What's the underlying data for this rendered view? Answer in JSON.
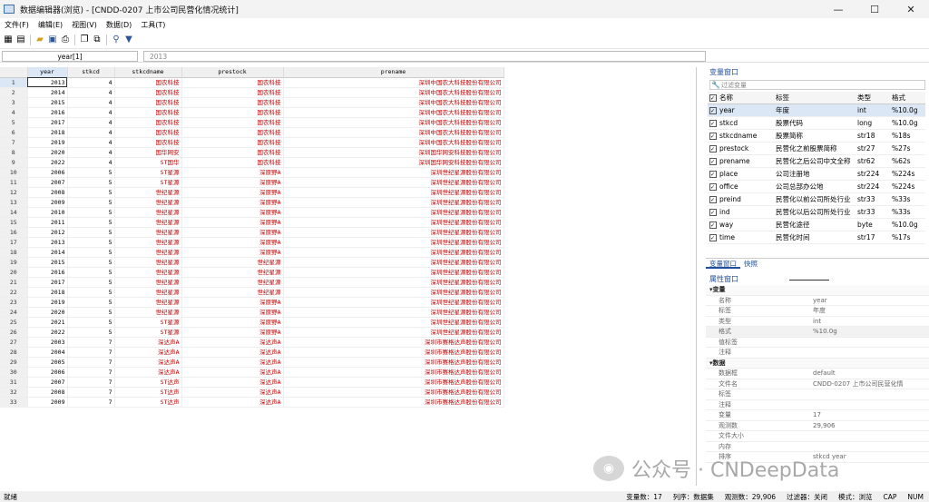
{
  "window": {
    "title": "数据编辑器(浏览) - [CNDD-0207 上市公司民营化情况统计]"
  },
  "menu": [
    "文件(F)",
    "编辑(E)",
    "视图(V)",
    "数据(D)",
    "工具(T)"
  ],
  "formula": {
    "var_ref": "year[1]",
    "cell_value": "2013"
  },
  "columns": [
    "year",
    "stkcd",
    "stkcdname",
    "prestock",
    "prename"
  ],
  "rows": [
    [
      "1",
      "2013",
      "4",
      "国农科技",
      "国农科技",
      "深圳中国农大科技股份有限公司"
    ],
    [
      "2",
      "2014",
      "4",
      "国农科技",
      "国农科技",
      "深圳中国农大科技股份有限公司"
    ],
    [
      "3",
      "2015",
      "4",
      "国农科技",
      "国农科技",
      "深圳中国农大科技股份有限公司"
    ],
    [
      "4",
      "2016",
      "4",
      "国农科技",
      "国农科技",
      "深圳中国农大科技股份有限公司"
    ],
    [
      "5",
      "2017",
      "4",
      "国农科技",
      "国农科技",
      "深圳中国农大科技股份有限公司"
    ],
    [
      "6",
      "2018",
      "4",
      "国农科技",
      "国农科技",
      "深圳中国农大科技股份有限公司"
    ],
    [
      "7",
      "2019",
      "4",
      "国农科技",
      "国农科技",
      "深圳中国农大科技股份有限公司"
    ],
    [
      "8",
      "2020",
      "4",
      "国华网安",
      "国农科技",
      "深圳国华网安科技股份有限公司"
    ],
    [
      "9",
      "2022",
      "4",
      "ST国华",
      "国农科技",
      "深圳国华网安科技股份有限公司"
    ],
    [
      "10",
      "2006",
      "5",
      "ST星源",
      "深原野A",
      "深圳世纪星源股份有限公司"
    ],
    [
      "11",
      "2007",
      "5",
      "ST星源",
      "深原野A",
      "深圳世纪星源股份有限公司"
    ],
    [
      "12",
      "2008",
      "5",
      "世纪星源",
      "深原野A",
      "深圳世纪星源股份有限公司"
    ],
    [
      "13",
      "2009",
      "5",
      "世纪星源",
      "深原野A",
      "深圳世纪星源股份有限公司"
    ],
    [
      "14",
      "2010",
      "5",
      "世纪星源",
      "深原野A",
      "深圳世纪星源股份有限公司"
    ],
    [
      "15",
      "2011",
      "5",
      "世纪星源",
      "深原野A",
      "深圳世纪星源股份有限公司"
    ],
    [
      "16",
      "2012",
      "5",
      "世纪星源",
      "深原野A",
      "深圳世纪星源股份有限公司"
    ],
    [
      "17",
      "2013",
      "5",
      "世纪星源",
      "深原野A",
      "深圳世纪星源股份有限公司"
    ],
    [
      "18",
      "2014",
      "5",
      "世纪星源",
      "深原野A",
      "深圳世纪星源股份有限公司"
    ],
    [
      "19",
      "2015",
      "5",
      "世纪星源",
      "世纪星源",
      "深圳世纪星源股份有限公司"
    ],
    [
      "20",
      "2016",
      "5",
      "世纪星源",
      "世纪星源",
      "深圳世纪星源股份有限公司"
    ],
    [
      "21",
      "2017",
      "5",
      "世纪星源",
      "世纪星源",
      "深圳世纪星源股份有限公司"
    ],
    [
      "22",
      "2018",
      "5",
      "世纪星源",
      "世纪星源",
      "深圳世纪星源股份有限公司"
    ],
    [
      "23",
      "2019",
      "5",
      "世纪星源",
      "深原野A",
      "深圳世纪星源股份有限公司"
    ],
    [
      "24",
      "2020",
      "5",
      "世纪星源",
      "深原野A",
      "深圳世纪星源股份有限公司"
    ],
    [
      "25",
      "2021",
      "5",
      "ST星源",
      "深原野A",
      "深圳世纪星源股份有限公司"
    ],
    [
      "26",
      "2022",
      "5",
      "ST星源",
      "深原野A",
      "深圳世纪星源股份有限公司"
    ],
    [
      "27",
      "2003",
      "7",
      "深达声A",
      "深达声A",
      "深圳市赛格达声股份有限公司"
    ],
    [
      "28",
      "2004",
      "7",
      "深达声A",
      "深达声A",
      "深圳市赛格达声股份有限公司"
    ],
    [
      "29",
      "2005",
      "7",
      "深达声A",
      "深达声A",
      "深圳市赛格达声股份有限公司"
    ],
    [
      "30",
      "2006",
      "7",
      "深达声A",
      "深达声A",
      "深圳市赛格达声股份有限公司"
    ],
    [
      "31",
      "2007",
      "7",
      "ST达声",
      "深达声A",
      "深圳市赛格达声股份有限公司"
    ],
    [
      "32",
      "2008",
      "7",
      "ST达声",
      "深达声A",
      "深圳市赛格达声股份有限公司"
    ],
    [
      "33",
      "2009",
      "7",
      "ST达声",
      "深达声A",
      "深圳市赛格达声股份有限公司"
    ]
  ],
  "variables_panel": {
    "title": "变量窗口",
    "filter_placeholder": "过滤变量",
    "headers": {
      "name": "名称",
      "label": "标签",
      "type": "类型",
      "format": "格式"
    },
    "items": [
      {
        "name": "year",
        "label": "年度",
        "type": "int",
        "format": "%10.0g"
      },
      {
        "name": "stkcd",
        "label": "股票代码",
        "type": "long",
        "format": "%10.0g"
      },
      {
        "name": "stkcdname",
        "label": "股票简称",
        "type": "str18",
        "format": "%18s"
      },
      {
        "name": "prestock",
        "label": "民营化之前股票简称",
        "type": "str27",
        "format": "%27s"
      },
      {
        "name": "prename",
        "label": "民营化之后公司中文全称",
        "type": "str62",
        "format": "%62s"
      },
      {
        "name": "place",
        "label": "公司注册地",
        "type": "str224",
        "format": "%224s"
      },
      {
        "name": "office",
        "label": "公司总部办公地",
        "type": "str224",
        "format": "%224s"
      },
      {
        "name": "preind",
        "label": "民营化以前公司所处行业",
        "type": "str33",
        "format": "%33s"
      },
      {
        "name": "ind",
        "label": "民营化以后公司所处行业",
        "type": "str33",
        "format": "%33s"
      },
      {
        "name": "way",
        "label": "民营化途径",
        "type": "byte",
        "format": "%10.0g"
      },
      {
        "name": "time",
        "label": "民营化时间",
        "type": "str17",
        "format": "%17s"
      }
    ]
  },
  "panel_tabs": [
    "变量窗口",
    "快照"
  ],
  "properties_panel": {
    "title": "属性窗口",
    "var_section": "变量",
    "var_props": [
      {
        "k": "名称",
        "v": "year"
      },
      {
        "k": "标签",
        "v": "年度"
      },
      {
        "k": "类型",
        "v": "int"
      },
      {
        "k": "格式",
        "v": "%10.0g"
      },
      {
        "k": "值标签",
        "v": ""
      },
      {
        "k": "注释",
        "v": ""
      }
    ],
    "data_section": "数据",
    "data_props": [
      {
        "k": "数据框",
        "v": "default"
      },
      {
        "k": "文件名",
        "v": "CNDD-0207 上市公司民营化情"
      },
      {
        "k": "标签",
        "v": ""
      },
      {
        "k": "注释",
        "v": ""
      },
      {
        "k": "变量",
        "v": "17"
      },
      {
        "k": "观测数",
        "v": "29,906"
      },
      {
        "k": "文件大小",
        "v": ""
      },
      {
        "k": "内存",
        "v": ""
      },
      {
        "k": "排序",
        "v": "stkcd year"
      }
    ]
  },
  "watermark": "公众号 · CNDeepData",
  "status": {
    "left": "就绪",
    "vars": "变量数：17",
    "order": "列序：数据集",
    "obs": "观测数：29,906",
    "filter": "过滤器：关闭",
    "mode": "模式：浏览",
    "cap": "CAP",
    "num": "NUM"
  }
}
